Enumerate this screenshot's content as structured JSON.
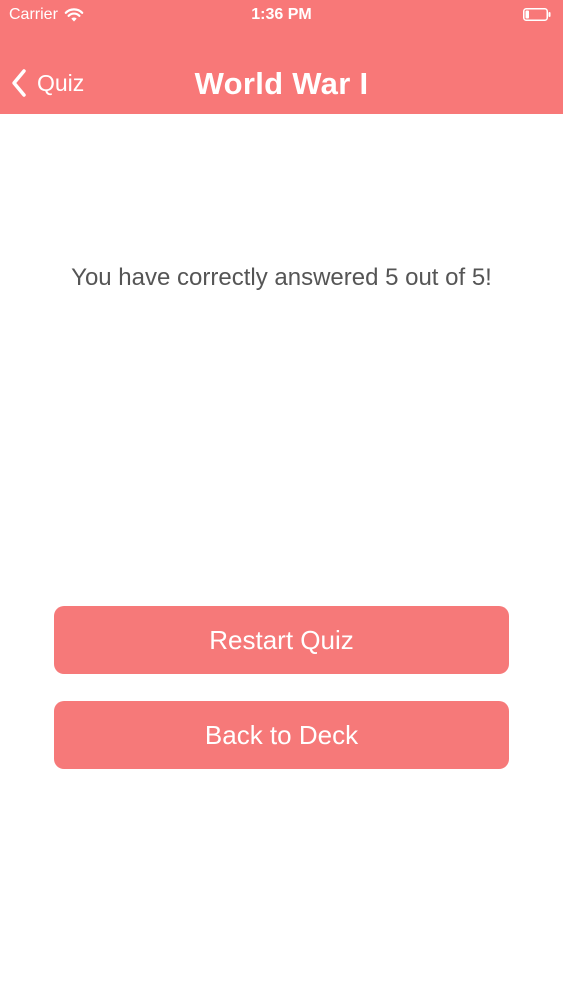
{
  "status_bar": {
    "carrier": "Carrier",
    "time": "1:36 PM"
  },
  "nav": {
    "back_label": "Quiz",
    "title": "World War I"
  },
  "result": {
    "message": "You have correctly answered 5 out of 5!"
  },
  "buttons": {
    "restart_label": "Restart Quiz",
    "back_to_deck_label": "Back to Deck"
  },
  "colors": {
    "accent": "#f87878",
    "button": "#f67979",
    "text": "#555555"
  }
}
